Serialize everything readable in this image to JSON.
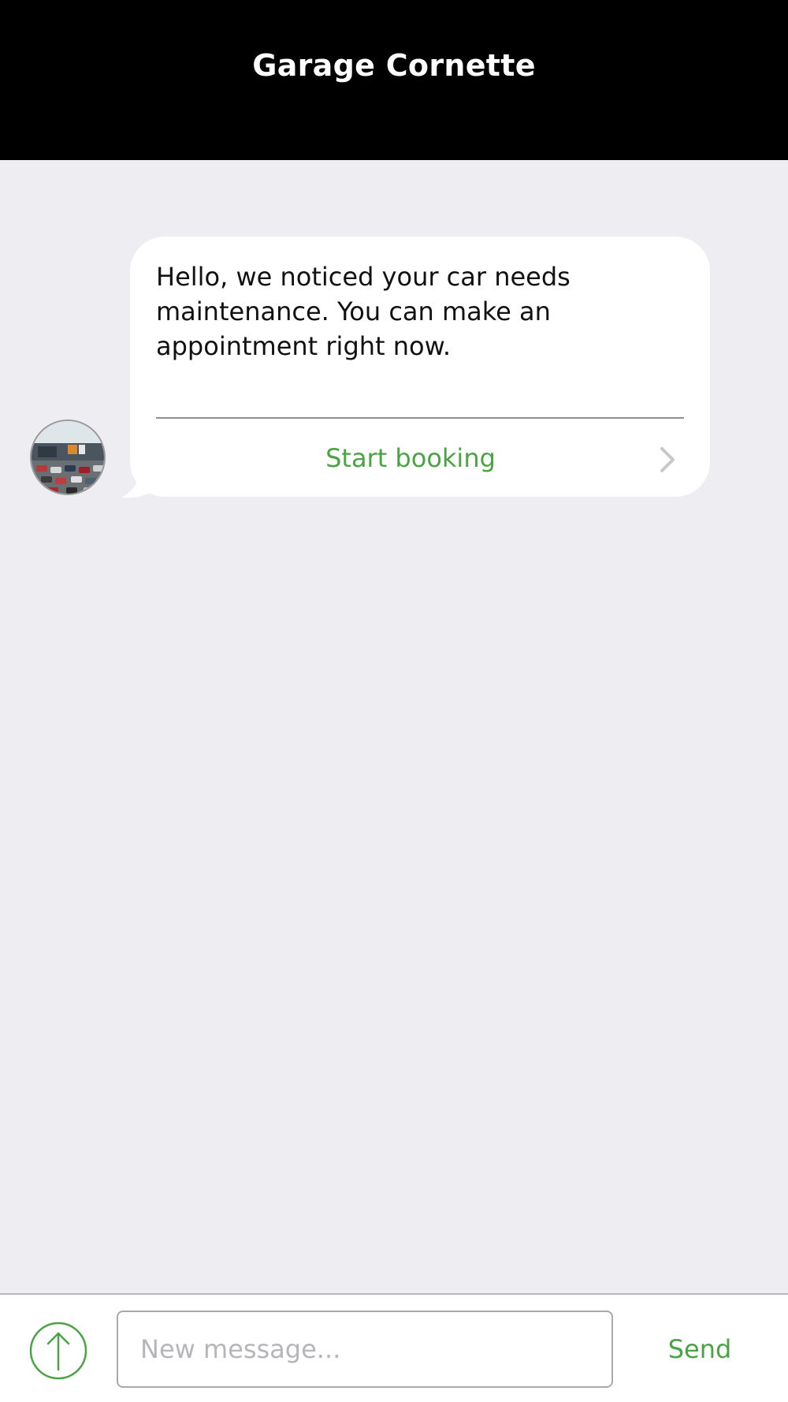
{
  "header": {
    "title": "Garage Cornette"
  },
  "conversation": {
    "messages": [
      {
        "text": "Hello, we noticed your car needs maintenance. You can make an appointment right now.",
        "action_label": "Start booking",
        "avatar_icon": "garage-photo-avatar"
      }
    ]
  },
  "composer": {
    "placeholder": "New message...",
    "value": "",
    "send_label": "Send",
    "upload_icon": "arrow-up-circle-icon"
  },
  "colors": {
    "accent": "#4ba345",
    "header_bg": "#000000",
    "chat_bg": "#eeedf2",
    "bubble_bg": "#ffffff"
  }
}
